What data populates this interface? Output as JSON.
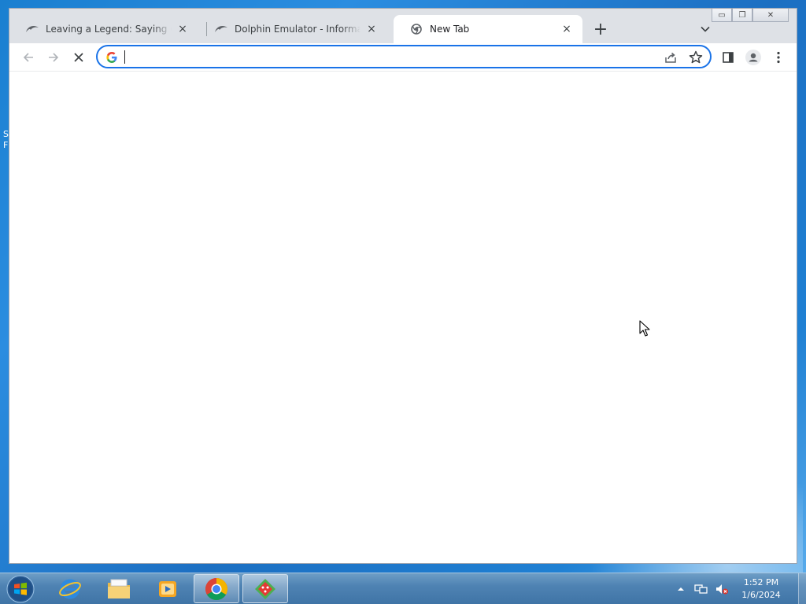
{
  "desktop": {
    "peek_text": "S F"
  },
  "browser": {
    "tabs": [
      {
        "title": "Leaving a Legend: Saying Goodbye",
        "favicon": "dolphin-icon",
        "active": false
      },
      {
        "title": "Dolphin Emulator - Information on",
        "favicon": "dolphin-icon",
        "active": false
      },
      {
        "title": "New Tab",
        "favicon": "chrome-icon",
        "active": true
      }
    ],
    "new_tab_label": "+",
    "tab_close_glyph": "×",
    "window_controls": {
      "minimize": "▭",
      "restore": "❐",
      "close": "✕"
    },
    "omnibox": {
      "value": "",
      "placeholder": ""
    },
    "accent_color": "#1a73e8"
  },
  "taskbar": {
    "apps": [
      {
        "name": "internet-explorer-icon",
        "active": false
      },
      {
        "name": "file-explorer-icon",
        "active": false
      },
      {
        "name": "media-player-icon",
        "active": false
      },
      {
        "name": "chrome-icon",
        "active": true
      },
      {
        "name": "game-app-icon",
        "active": true
      }
    ],
    "clock": {
      "time": "1:52 PM",
      "date": "1/6/2024"
    }
  }
}
